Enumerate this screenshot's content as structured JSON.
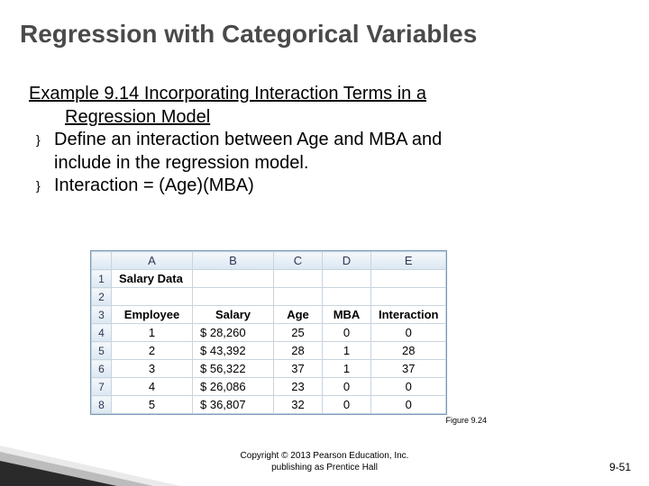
{
  "title": "Regression with Categorical Variables",
  "example_line": "Example 9.14  Incorporating Interaction Terms in a",
  "example_cont": "Regression Model",
  "bullets": {
    "b1a": "Define an interaction between Age and MBA and",
    "b1b": "include in the regression model.",
    "b2": "Interaction = (Age)(MBA)"
  },
  "bullet_marks": {
    "m1": "}",
    "m2": "}"
  },
  "sheet": {
    "cols": [
      "A",
      "B",
      "C",
      "D",
      "E"
    ],
    "row_labels": [
      "1",
      "2",
      "3",
      "4",
      "5",
      "6",
      "7",
      "8"
    ],
    "r1": {
      "title": "Salary Data"
    },
    "r3": {
      "a": "Employee",
      "b": "Salary",
      "c": "Age",
      "d": "MBA",
      "e": "Interaction"
    },
    "r4": {
      "a": "1",
      "b": "$      28,260",
      "c": "25",
      "d": "0",
      "e": "0"
    },
    "r5": {
      "a": "2",
      "b": "$      43,392",
      "c": "28",
      "d": "1",
      "e": "28"
    },
    "r6": {
      "a": "3",
      "b": "$      56,322",
      "c": "37",
      "d": "1",
      "e": "37"
    },
    "r7": {
      "a": "4",
      "b": "$      26,086",
      "c": "23",
      "d": "0",
      "e": "0"
    },
    "r8": {
      "a": "5",
      "b": "$      36,807",
      "c": "32",
      "d": "0",
      "e": "0"
    }
  },
  "figure_caption": "Figure 9.24",
  "copyright1": "Copyright © 2013 Pearson Education, Inc.",
  "copyright2": "publishing as Prentice Hall",
  "page_number": "9-51",
  "chart_data": {
    "type": "table",
    "title": "Salary Data",
    "columns": [
      "Employee",
      "Salary",
      "Age",
      "MBA",
      "Interaction"
    ],
    "rows": [
      {
        "Employee": 1,
        "Salary": 28260,
        "Age": 25,
        "MBA": 0,
        "Interaction": 0
      },
      {
        "Employee": 2,
        "Salary": 43392,
        "Age": 28,
        "MBA": 1,
        "Interaction": 28
      },
      {
        "Employee": 3,
        "Salary": 56322,
        "Age": 37,
        "MBA": 1,
        "Interaction": 37
      },
      {
        "Employee": 4,
        "Salary": 26086,
        "Age": 23,
        "MBA": 0,
        "Interaction": 0
      },
      {
        "Employee": 5,
        "Salary": 36807,
        "Age": 32,
        "MBA": 0,
        "Interaction": 0
      }
    ]
  }
}
